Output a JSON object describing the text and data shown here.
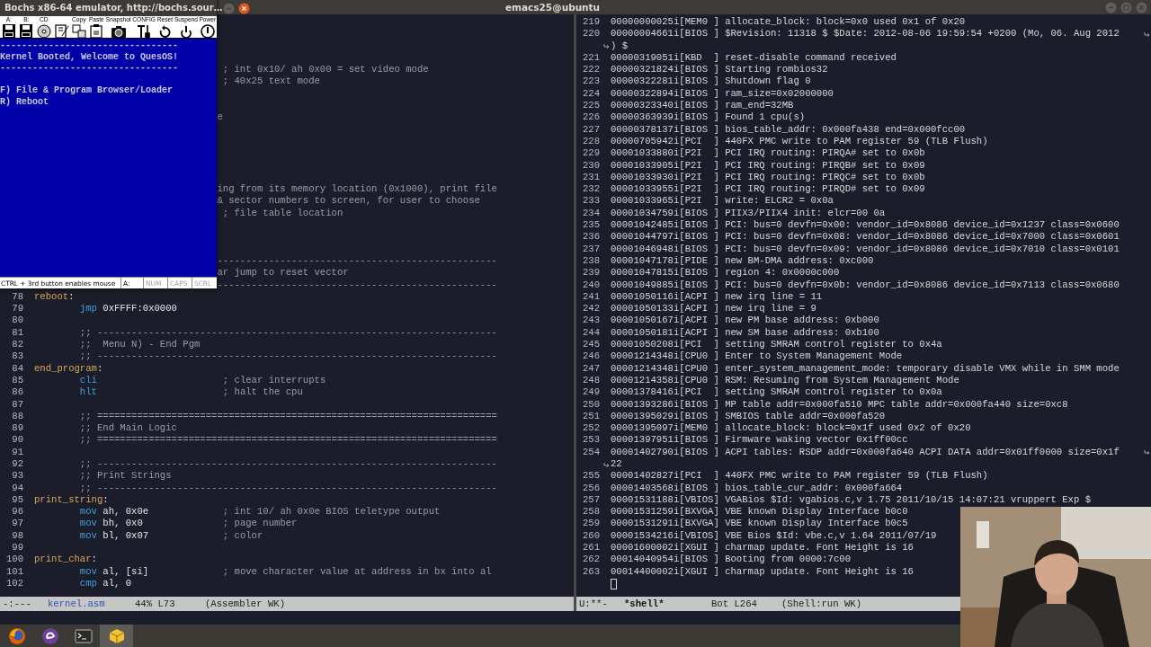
{
  "top_bar": {
    "title": "emacs25@ubuntu",
    "focused": false,
    "buttons": [
      {
        "kind": "minimize"
      },
      {
        "kind": "maximize"
      },
      {
        "kind": "close"
      }
    ]
  },
  "bochs": {
    "title": "Bochs x86-64 emulator, http://bochs.sour…",
    "focused": true,
    "title_buttons": [
      {
        "kind": "minimize"
      },
      {
        "kind": "close"
      }
    ],
    "toolbar": [
      {
        "kind": "floppy",
        "label": "A:"
      },
      {
        "kind": "floppy",
        "label": "B:"
      },
      {
        "kind": "cdrom",
        "label": "CD"
      },
      {
        "kind": "usb"
      },
      {
        "kind": "copy",
        "label": "Copy"
      },
      {
        "kind": "paste",
        "label": "Paste"
      },
      {
        "kind": "snapshot",
        "label": "Snapshot"
      },
      {
        "kind": "config",
        "label": "CONFIG"
      },
      {
        "kind": "reset",
        "label": "Reset"
      },
      {
        "kind": "suspend",
        "label": "Suspend"
      },
      {
        "kind": "power",
        "label": "Power"
      }
    ],
    "banner": [
      "---------------------------------",
      "Kernel Booted, Welcome to QuesOS!",
      "---------------------------------"
    ],
    "menu": [
      "F) File & Program Browser/Loader",
      "R) Reboot"
    ],
    "status": {
      "message": "CTRL + 3rd button enables mouse",
      "drive": "A:",
      "indicators": [
        {
          "label": "NUM",
          "on": false
        },
        {
          "label": "CAPS",
          "on": false
        },
        {
          "label": "SCRL",
          "on": false
        }
      ]
    }
  },
  "editor": {
    "left": {
      "active": false,
      "covered_lines": [
        {
          "text": "; int 0x10/ ah 0x00 = set video mode"
        },
        {
          "text": "; 40x25 text mode"
        },
        {
          "text": "e"
        },
        {
          "text": "ing from its memory location (0x1000), print file"
        },
        {
          "text": "& sector numbers to screen, for user to choose"
        },
        {
          "text": "; file table location"
        },
        {
          "text": "-------------------------------------------------"
        },
        {
          "text": "ar jump to reset vector"
        },
        {
          "text": "-------------------------------------------------"
        }
      ],
      "lines": [
        {
          "number": "78",
          "tokens": [
            {
              "kind": "label",
              "text": "reboot"
            },
            {
              "kind": "plain",
              "text": ":"
            }
          ]
        },
        {
          "number": "79",
          "tokens": [
            {
              "kind": "op",
              "text": "jmp"
            },
            {
              "kind": "args",
              "text": "0xFFFF:0x0000"
            }
          ]
        },
        {
          "number": "80"
        },
        {
          "number": "81",
          "tokens": [
            {
              "kind": "comment",
              "text": ";; ----------------------------------------------------------------------"
            }
          ]
        },
        {
          "number": "82",
          "tokens": [
            {
              "kind": "comment",
              "text": ";;  Menu N) - End Pgm"
            }
          ]
        },
        {
          "number": "83",
          "tokens": [
            {
              "kind": "comment",
              "text": ";; ----------------------------------------------------------------------"
            }
          ]
        },
        {
          "number": "84",
          "tokens": [
            {
              "kind": "label",
              "text": "end_program"
            },
            {
              "kind": "plain",
              "text": ":"
            }
          ]
        },
        {
          "number": "85",
          "tokens": [
            {
              "kind": "op",
              "text": "cli"
            },
            {
              "kind": "comment",
              "text": "; clear interrupts"
            }
          ]
        },
        {
          "number": "86",
          "tokens": [
            {
              "kind": "op",
              "text": "hlt"
            },
            {
              "kind": "comment",
              "text": "; halt the cpu"
            }
          ]
        },
        {
          "number": "87"
        },
        {
          "number": "88",
          "tokens": [
            {
              "kind": "comment",
              "text": ";; ======================================================================"
            }
          ]
        },
        {
          "number": "89",
          "tokens": [
            {
              "kind": "comment",
              "text": ";; End Main Logic"
            }
          ]
        },
        {
          "number": "90",
          "tokens": [
            {
              "kind": "comment",
              "text": ";; ======================================================================"
            }
          ]
        },
        {
          "number": "91"
        },
        {
          "number": "92",
          "tokens": [
            {
              "kind": "comment",
              "text": ";; ----------------------------------------------------------------------"
            }
          ]
        },
        {
          "number": "93",
          "tokens": [
            {
              "kind": "comment",
              "text": ";; Print Strings"
            }
          ]
        },
        {
          "number": "94",
          "tokens": [
            {
              "kind": "comment",
              "text": ";; ----------------------------------------------------------------------"
            }
          ]
        },
        {
          "number": "95",
          "tokens": [
            {
              "kind": "label",
              "text": "print_string"
            },
            {
              "kind": "plain",
              "text": ":"
            }
          ]
        },
        {
          "number": "96",
          "tokens": [
            {
              "kind": "op",
              "text": "mov"
            },
            {
              "kind": "args",
              "text": "ah, 0x0e"
            },
            {
              "kind": "comment",
              "text": "; int 10/ ah 0x0e BIOS teletype output"
            }
          ]
        },
        {
          "number": "97",
          "tokens": [
            {
              "kind": "op",
              "text": "mov"
            },
            {
              "kind": "args",
              "text": "bh, 0x0"
            },
            {
              "kind": "comment",
              "text": "; page number"
            }
          ]
        },
        {
          "number": "98",
          "tokens": [
            {
              "kind": "op",
              "text": "mov"
            },
            {
              "kind": "args",
              "text": "bl, 0x07"
            },
            {
              "kind": "comment",
              "text": "; color"
            }
          ]
        },
        {
          "number": "99"
        },
        {
          "number": "100",
          "tokens": [
            {
              "kind": "label",
              "text": "print_char"
            },
            {
              "kind": "plain",
              "text": ":"
            }
          ]
        },
        {
          "number": "101",
          "tokens": [
            {
              "kind": "op",
              "text": "mov"
            },
            {
              "kind": "args",
              "text": "al, [si]"
            },
            {
              "kind": "comment",
              "text": "; move character value at address in bx into al"
            }
          ]
        },
        {
          "number": "102",
          "tokens": [
            {
              "kind": "op",
              "text": "cmp"
            },
            {
              "kind": "args",
              "text": "al, 0"
            }
          ]
        }
      ],
      "modeline": {
        "state": "-:---",
        "buffer": "kernel.asm",
        "position": "44% L73",
        "mode": "(Assembler WK)"
      }
    },
    "right": {
      "active": true,
      "prompt_cursor": true,
      "lines": [
        {
          "number": "219",
          "text": "00000000025i[MEM0 ] allocate_block: block=0x0 used 0x1 of 0x20"
        },
        {
          "number": "220",
          "text": "00000004661i[BIOS ] $Revision: 11318 $ $Date: 2012-08-06 19:59:54 +0200 (Mo, 06. Aug 2012",
          "continuation": ") $"
        },
        {
          "number": "221",
          "text": "00000319051i[KBD  ] reset-disable command received"
        },
        {
          "number": "222",
          "text": "00000321824i[BIOS ] Starting rombios32"
        },
        {
          "number": "223",
          "text": "00000322281i[BIOS ] Shutdown flag 0"
        },
        {
          "number": "224",
          "text": "00000322894i[BIOS ] ram_size=0x02000000"
        },
        {
          "number": "225",
          "text": "00000323340i[BIOS ] ram_end=32MB"
        },
        {
          "number": "226",
          "text": "00000363939i[BIOS ] Found 1 cpu(s)"
        },
        {
          "number": "227",
          "text": "00000378137i[BIOS ] bios_table_addr: 0x000fa438 end=0x000fcc00"
        },
        {
          "number": "228",
          "text": "00000705942i[PCI  ] 440FX PMC write to PAM register 59 (TLB Flush)"
        },
        {
          "number": "229",
          "text": "00001033880i[P2I  ] PCI IRQ routing: PIRQA# set to 0x0b"
        },
        {
          "number": "230",
          "text": "00001033905i[P2I  ] PCI IRQ routing: PIRQB# set to 0x09"
        },
        {
          "number": "231",
          "text": "00001033930i[P2I  ] PCI IRQ routing: PIRQC# set to 0x0b"
        },
        {
          "number": "232",
          "text": "00001033955i[P2I  ] PCI IRQ routing: PIRQD# set to 0x09"
        },
        {
          "number": "233",
          "text": "00001033965i[P2I  ] write: ELCR2 = 0x0a"
        },
        {
          "number": "234",
          "text": "00001034759i[BIOS ] PIIX3/PIIX4 init: elcr=00 0a"
        },
        {
          "number": "235",
          "text": "00001042485i[BIOS ] PCI: bus=0 devfn=0x00: vendor_id=0x8086 device_id=0x1237 class=0x0600"
        },
        {
          "number": "236",
          "text": "00001044797i[BIOS ] PCI: bus=0 devfn=0x08: vendor_id=0x8086 device_id=0x7000 class=0x0601"
        },
        {
          "number": "237",
          "text": "00001046948i[BIOS ] PCI: bus=0 devfn=0x09: vendor_id=0x8086 device_id=0x7010 class=0x0101"
        },
        {
          "number": "238",
          "text": "00001047178i[PIDE ] new BM-DMA address: 0xc000"
        },
        {
          "number": "239",
          "text": "00001047815i[BIOS ] region 4: 0x0000c000"
        },
        {
          "number": "240",
          "text": "00001049885i[BIOS ] PCI: bus=0 devfn=0x0b: vendor_id=0x8086 device_id=0x7113 class=0x0680"
        },
        {
          "number": "241",
          "text": "00001050116i[ACPI ] new irq line = 11"
        },
        {
          "number": "242",
          "text": "00001050133i[ACPI ] new irq line = 9"
        },
        {
          "number": "243",
          "text": "00001050167i[ACPI ] new PM base address: 0xb000"
        },
        {
          "number": "244",
          "text": "00001050181i[ACPI ] new SM base address: 0xb100"
        },
        {
          "number": "245",
          "text": "00001050208i[PCI  ] setting SMRAM control register to 0x4a"
        },
        {
          "number": "246",
          "text": "00001214348i[CPU0 ] Enter to System Management Mode"
        },
        {
          "number": "247",
          "text": "00001214348i[CPU0 ] enter_system_management_mode: temporary disable VMX while in SMM mode"
        },
        {
          "number": "248",
          "text": "00001214358i[CPU0 ] RSM: Resuming from System Management Mode"
        },
        {
          "number": "249",
          "text": "00001378416i[PCI  ] setting SMRAM control register to 0x0a"
        },
        {
          "number": "250",
          "text": "00001393286i[BIOS ] MP table addr=0x000fa510 MPC table addr=0x000fa440 size=0xc8"
        },
        {
          "number": "251",
          "text": "00001395029i[BIOS ] SMBIOS table addr=0x000fa520"
        },
        {
          "number": "252",
          "text": "00001395097i[MEM0 ] allocate_block: block=0x1f used 0x2 of 0x20"
        },
        {
          "number": "253",
          "text": "00001397951i[BIOS ] Firmware waking vector 0x1ff00cc"
        },
        {
          "number": "254",
          "text": "00001402790i[BIOS ] ACPI tables: RSDP addr=0x000fa640 ACPI DATA addr=0x01ff0000 size=0x1f",
          "continuation": "22"
        },
        {
          "number": "255",
          "text": "00001402827i[PCI  ] 440FX PMC write to PAM register 59 (TLB Flush)"
        },
        {
          "number": "256",
          "text": "00001403568i[BIOS ] bios_table_cur_addr: 0x000fa664"
        },
        {
          "number": "257",
          "text": "00001531188i[VBIOS] VGABios $Id: vgabios.c,v 1.75 2011/10/15 14:07:21 vruppert Exp $"
        },
        {
          "number": "258",
          "text": "00001531259i[BXVGA] VBE known Display Interface b0c0"
        },
        {
          "number": "259",
          "text": "00001531291i[BXVGA] VBE known Display Interface b0c5"
        },
        {
          "number": "260",
          "text": "00001534216i[VBIOS] VBE Bios $Id: vbe.c,v 1.64 2011/07/19"
        },
        {
          "number": "261",
          "text": "00001600002i[XGUI ] charmap update. Font Height is 16"
        },
        {
          "number": "262",
          "text": "00014040954i[BIOS ] Booting from 0000:7c00"
        },
        {
          "number": "263",
          "text": "00014400002i[XGUI ] charmap update. Font Height is 16"
        }
      ],
      "modeline": {
        "state": "U:**-",
        "buffer": "*shell*",
        "position": "Bot L264",
        "mode": "(Shell:run WK)"
      }
    }
  },
  "dock": [
    {
      "kind": "browser",
      "selected": false
    },
    {
      "kind": "editor",
      "selected": false
    },
    {
      "kind": "terminal",
      "selected": false
    },
    {
      "kind": "emulator",
      "selected": true
    }
  ]
}
